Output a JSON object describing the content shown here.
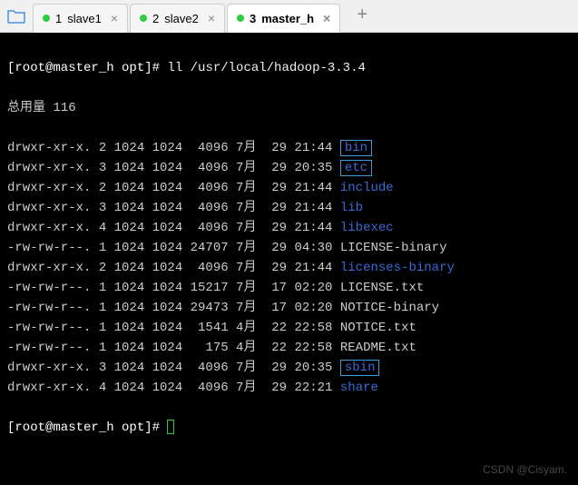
{
  "tabs": [
    {
      "index": "1",
      "label": "slave1",
      "active": false
    },
    {
      "index": "2",
      "label": "slave2",
      "active": false
    },
    {
      "index": "3",
      "label": "master_h",
      "active": true
    }
  ],
  "prompt1": {
    "user_host": "[root@master_h opt]#",
    "command": "ll /usr/local/hadoop-3.3.4"
  },
  "total_line": "总用量 116",
  "listing": [
    {
      "perm": "drwxr-xr-x.",
      "links": "2",
      "owner": "1024",
      "group": "1024",
      "size": "4096",
      "month": "7月",
      "day": "29",
      "time": "21:44",
      "name": "bin",
      "type": "dir",
      "boxed": true
    },
    {
      "perm": "drwxr-xr-x.",
      "links": "3",
      "owner": "1024",
      "group": "1024",
      "size": "4096",
      "month": "7月",
      "day": "29",
      "time": "20:35",
      "name": "etc",
      "type": "dir",
      "boxed": true
    },
    {
      "perm": "drwxr-xr-x.",
      "links": "2",
      "owner": "1024",
      "group": "1024",
      "size": "4096",
      "month": "7月",
      "day": "29",
      "time": "21:44",
      "name": "include",
      "type": "dir",
      "boxed": false
    },
    {
      "perm": "drwxr-xr-x.",
      "links": "3",
      "owner": "1024",
      "group": "1024",
      "size": "4096",
      "month": "7月",
      "day": "29",
      "time": "21:44",
      "name": "lib",
      "type": "dir",
      "boxed": false
    },
    {
      "perm": "drwxr-xr-x.",
      "links": "4",
      "owner": "1024",
      "group": "1024",
      "size": "4096",
      "month": "7月",
      "day": "29",
      "time": "21:44",
      "name": "libexec",
      "type": "dir",
      "boxed": false
    },
    {
      "perm": "-rw-rw-r--.",
      "links": "1",
      "owner": "1024",
      "group": "1024",
      "size": "24707",
      "month": "7月",
      "day": "29",
      "time": "04:30",
      "name": "LICENSE-binary",
      "type": "file",
      "boxed": false
    },
    {
      "perm": "drwxr-xr-x.",
      "links": "2",
      "owner": "1024",
      "group": "1024",
      "size": "4096",
      "month": "7月",
      "day": "29",
      "time": "21:44",
      "name": "licenses-binary",
      "type": "dir",
      "boxed": false
    },
    {
      "perm": "-rw-rw-r--.",
      "links": "1",
      "owner": "1024",
      "group": "1024",
      "size": "15217",
      "month": "7月",
      "day": "17",
      "time": "02:20",
      "name": "LICENSE.txt",
      "type": "file",
      "boxed": false
    },
    {
      "perm": "-rw-rw-r--.",
      "links": "1",
      "owner": "1024",
      "group": "1024",
      "size": "29473",
      "month": "7月",
      "day": "17",
      "time": "02:20",
      "name": "NOTICE-binary",
      "type": "file",
      "boxed": false
    },
    {
      "perm": "-rw-rw-r--.",
      "links": "1",
      "owner": "1024",
      "group": "1024",
      "size": "1541",
      "month": "4月",
      "day": "22",
      "time": "22:58",
      "name": "NOTICE.txt",
      "type": "file",
      "boxed": false
    },
    {
      "perm": "-rw-rw-r--.",
      "links": "1",
      "owner": "1024",
      "group": "1024",
      "size": "175",
      "month": "4月",
      "day": "22",
      "time": "22:58",
      "name": "README.txt",
      "type": "file",
      "boxed": false
    },
    {
      "perm": "drwxr-xr-x.",
      "links": "3",
      "owner": "1024",
      "group": "1024",
      "size": "4096",
      "month": "7月",
      "day": "29",
      "time": "20:35",
      "name": "sbin",
      "type": "dir",
      "boxed": true
    },
    {
      "perm": "drwxr-xr-x.",
      "links": "4",
      "owner": "1024",
      "group": "1024",
      "size": "4096",
      "month": "7月",
      "day": "29",
      "time": "22:21",
      "name": "share",
      "type": "dir",
      "boxed": false
    }
  ],
  "prompt2": {
    "user_host": "[root@master_h opt]#"
  },
  "watermark": "CSDN @Cisyam."
}
